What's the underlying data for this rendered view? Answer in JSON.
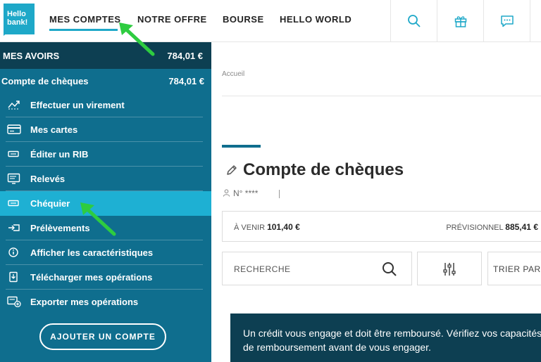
{
  "header": {
    "logo_line1": "Hello",
    "logo_line2": "bank!",
    "nav": [
      {
        "label": "MES COMPTES"
      },
      {
        "label": "NOTRE OFFRE"
      },
      {
        "label": "BOURSE"
      },
      {
        "label": "HELLO WORLD"
      }
    ],
    "icons": [
      "search-icon",
      "gift-icon",
      "chat-icon"
    ]
  },
  "sidebar": {
    "avoirs_label": "MES AVOIRS",
    "avoirs_amount": "784,01 €",
    "account_label": "Compte de chèques",
    "account_amount": "784,01 €",
    "items": [
      {
        "label": "Effectuer un virement",
        "icon": "transfer-icon"
      },
      {
        "label": "Mes cartes",
        "icon": "card-icon"
      },
      {
        "label": "Éditer un RIB",
        "icon": "rib-icon"
      },
      {
        "label": "Relevés",
        "icon": "statement-icon"
      },
      {
        "label": "Chéquier",
        "icon": "checkbook-icon"
      },
      {
        "label": "Prélèvements",
        "icon": "direct-debit-icon"
      },
      {
        "label": "Afficher les caractéristiques",
        "icon": "info-icon"
      },
      {
        "label": "Télécharger mes opérations",
        "icon": "download-icon"
      },
      {
        "label": "Exporter mes opérations",
        "icon": "export-icon"
      }
    ],
    "active_index": 4,
    "add_account_label": "AJOUTER UN COMPTE"
  },
  "main": {
    "breadcrumb": "Accueil",
    "title": "Compte de chèques",
    "account_number": "N° ****",
    "balance": {
      "upcoming_label": "À VENIR",
      "upcoming_amount": "101,40 €",
      "forecast_label": "PRÉVISIONNEL",
      "forecast_amount": "885,41 €"
    },
    "search_placeholder": "RECHERCHE",
    "sort_label": "TRIER PAR",
    "credit_notice": "Un crédit vous engage et doit être remboursé. Vérifiez vos capacités de remboursement avant de vous engager."
  },
  "colors": {
    "accent": "#1ea8c8",
    "sidebar": "#0f6e8e",
    "sidebar_dark": "#0d3f52",
    "active_item": "#1eb0d3",
    "annotation_arrow": "#2ecc40"
  }
}
